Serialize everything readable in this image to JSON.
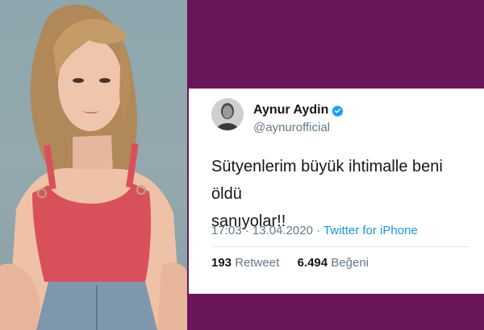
{
  "photo": {
    "subject": "woman-portrait"
  },
  "tweet": {
    "display_name": "Aynur Aydin",
    "handle": "@aynurofficial",
    "text_line1": "Sütyenlerim büyük ihtimalle beni öldü",
    "text_line2": "sanıyolar!!",
    "time": "17:03",
    "separator": "·",
    "date": "13.04.2020",
    "source": "Twitter for iPhone",
    "retweet_count": "193",
    "retweet_label": "Retweet",
    "like_count": "6.494",
    "like_label": "Beğeni",
    "verified_icon": "verified-badge-icon"
  },
  "colors": {
    "background_purple": "#6c165a",
    "card_white": "#ffffff",
    "link_blue": "#1b95e0",
    "verified_blue": "#1da1f2",
    "muted_gray": "#657786",
    "text_dark": "#14171a"
  }
}
